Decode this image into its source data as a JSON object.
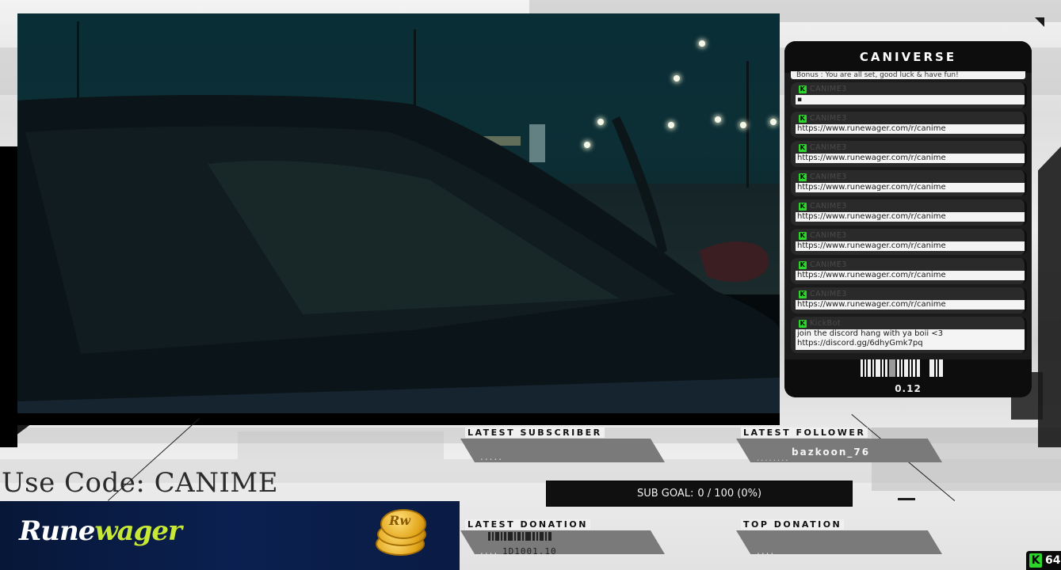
{
  "chat": {
    "title": "CANIVERSE",
    "bonus_line": "Bonus : You are all set, good luck & have fun!",
    "messages": [
      {
        "user": "CANIME3",
        "text": "὇b"
      },
      {
        "user": "CANIME3",
        "text": "https://www.runewager.com/r/canime"
      },
      {
        "user": "CANIME3",
        "text": "https://www.runewager.com/r/canime"
      },
      {
        "user": "CANIME3",
        "text": "https://www.runewager.com/r/canime"
      },
      {
        "user": "CANIME3",
        "text": "https://www.runewager.com/r/canime"
      },
      {
        "user": "CANIME3",
        "text": "https://www.runewager.com/r/canime"
      },
      {
        "user": "CANIME3",
        "text": "https://www.runewager.com/r/canime"
      },
      {
        "user": "CANIME3",
        "text": "https://www.runewager.com/r/canime"
      },
      {
        "user": "KickBot",
        "text": "join the discord hang with ya boii <3\nhttps://discord.gg/6dhyGmk7pq"
      }
    ],
    "footer_value": "0.12",
    "badge_letter": "K"
  },
  "overlay": {
    "use_code": "Use Code: CANIME",
    "latest_subscriber_label": "LATEST SUBSCRIBER",
    "latest_subscriber_value": ".....",
    "latest_follower_label": "LATEST FOLLOWER",
    "latest_follower_value": "bazkoon_76",
    "latest_follower_dots": "........",
    "latest_donation_label": "LATEST DONATION",
    "latest_donation_value": "....",
    "latest_donation_code": "1D1001.10",
    "top_donation_label": "TOP DONATION",
    "top_donation_value": "....",
    "sub_goal_label": "SUB GOAL:",
    "sub_goal_value": "0 / 100 (0%)"
  },
  "banner": {
    "brand_rune": "Rune",
    "brand_wager": "wager",
    "coin_text": "Rw"
  },
  "viewers": {
    "icon_letter": "K",
    "count": "64"
  },
  "colors": {
    "kick_green": "#2bd52b",
    "chat_dark": "#1b1b1b",
    "banner_navy": "#0b2050",
    "brand_accent": "#c7e835"
  }
}
